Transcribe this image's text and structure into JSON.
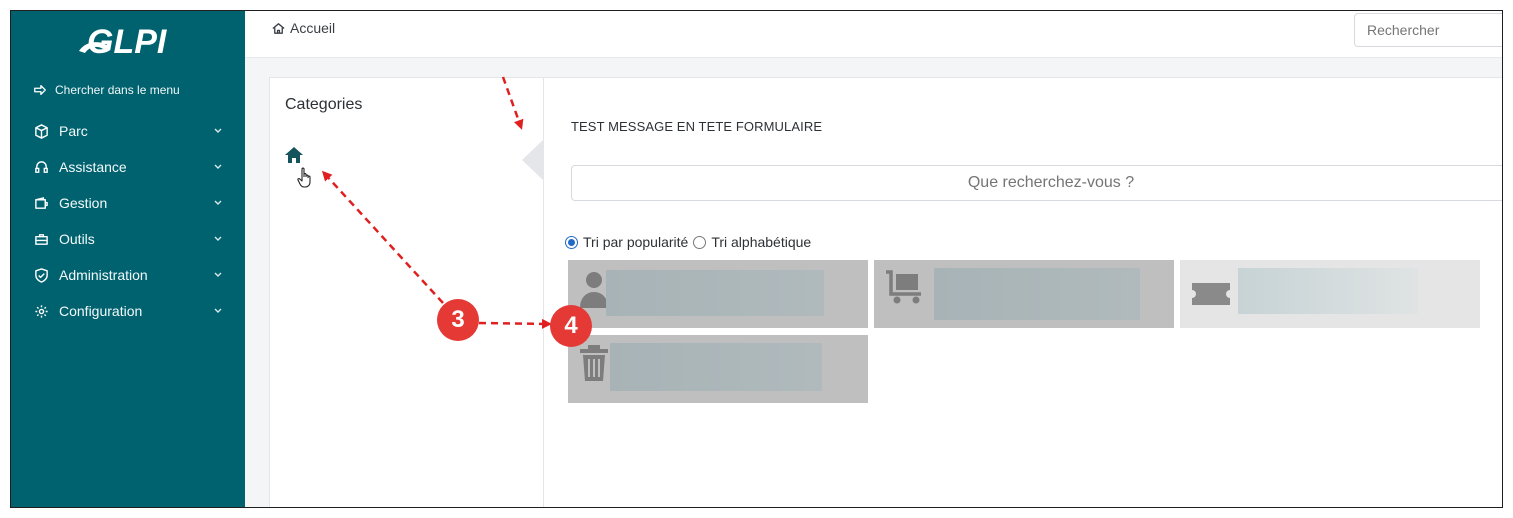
{
  "app": {
    "logo_text": "GLPI"
  },
  "sidebar": {
    "search_label": "Chercher dans le menu",
    "items": [
      {
        "label": "Parc",
        "icon": "box-icon"
      },
      {
        "label": "Assistance",
        "icon": "headset-icon"
      },
      {
        "label": "Gestion",
        "icon": "wallet-icon"
      },
      {
        "label": "Outils",
        "icon": "briefcase-icon"
      },
      {
        "label": "Administration",
        "icon": "shield-check-icon"
      },
      {
        "label": "Configuration",
        "icon": "gear-icon"
      }
    ]
  },
  "header": {
    "breadcrumb": "Accueil",
    "search_placeholder": "Rechercher"
  },
  "categories": {
    "title": "Categories"
  },
  "main": {
    "header_message": "TEST MESSAGE EN TETE FORMULAIRE",
    "search_placeholder": "Que recherchez-vous ?",
    "sort_options": [
      {
        "label": "Tri par popularité",
        "selected": true
      },
      {
        "label": "Tri alphabétique",
        "selected": false
      }
    ],
    "tiles": [
      {
        "icon": "user-icon"
      },
      {
        "icon": "cart-box-icon"
      },
      {
        "icon": "ticket-icon"
      },
      {
        "icon": "trash-icon"
      }
    ]
  },
  "annotations": {
    "badges": [
      "3",
      "4"
    ]
  },
  "colors": {
    "sidebar_bg": "#00626f",
    "accent": "#206bc4",
    "badge": "#e53935",
    "arrow": "#e02020"
  }
}
